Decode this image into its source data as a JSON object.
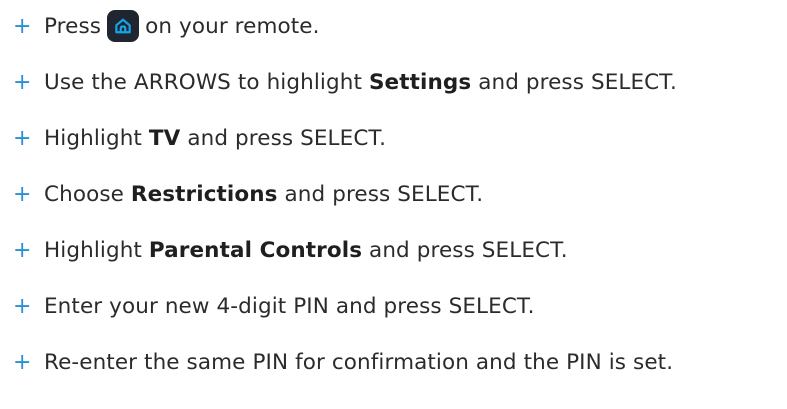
{
  "steps": [
    {
      "bullet": "+",
      "segments": [
        "Press",
        "on your remote."
      ],
      "icon": "home-icon",
      "icon_color": "#16a4ea",
      "icon_bg": "#1f2630"
    },
    {
      "bullet": "+",
      "segments": [
        "Use the ARROWS to highlight",
        "Settings",
        "and press SELECT."
      ]
    },
    {
      "bullet": "+",
      "segments": [
        "Highlight",
        "TV",
        "and press SELECT."
      ]
    },
    {
      "bullet": "+",
      "segments": [
        "Choose",
        "Restrictions",
        "and press SELECT."
      ]
    },
    {
      "bullet": "+",
      "segments": [
        "Highlight",
        "Parental Controls",
        "and press SELECT."
      ]
    },
    {
      "bullet": "+",
      "segments": [
        "Enter your new 4-digit PIN and press SELECT."
      ]
    },
    {
      "bullet": "+",
      "segments": [
        "Re-enter the same PIN for confirmation and the PIN is set."
      ]
    }
  ],
  "colors": {
    "bullet": "#2a8fd6",
    "text": "#2b2b2b"
  }
}
